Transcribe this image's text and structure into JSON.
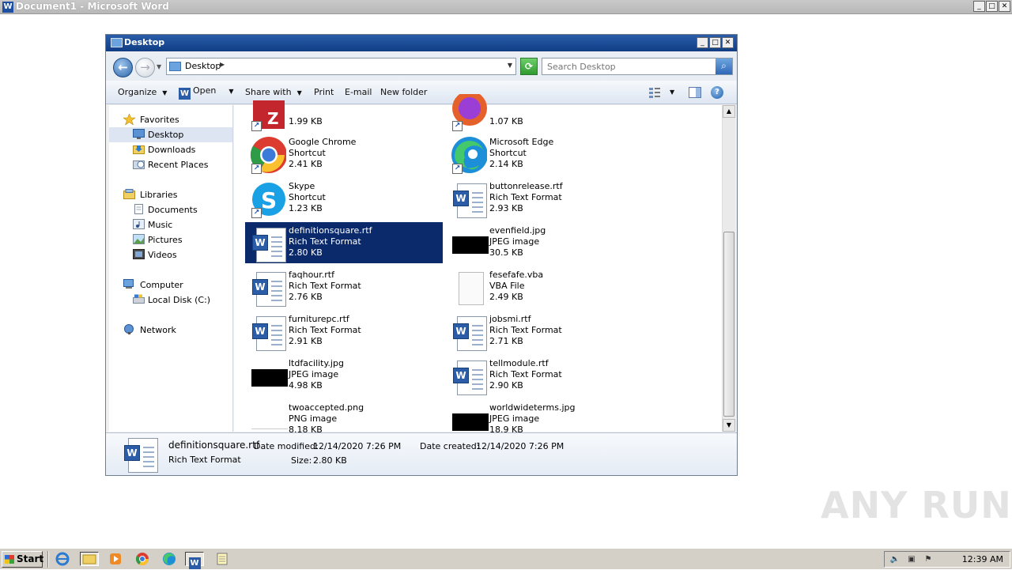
{
  "word_window": {
    "title": "Document1 - Microsoft Word",
    "app_icon_letter": "W"
  },
  "explorer": {
    "title": "Desktop",
    "address": {
      "location": "Desktop"
    },
    "search": {
      "placeholder": "Search Desktop"
    },
    "toolbar": {
      "organize": "Organize",
      "open": "Open",
      "share_with": "Share with",
      "print": "Print",
      "email": "E-mail",
      "new_folder": "New folder"
    },
    "navigation": {
      "favorites": "Favorites",
      "desktop": "Desktop",
      "downloads": "Downloads",
      "recent_places": "Recent Places",
      "libraries": "Libraries",
      "documents": "Documents",
      "music": "Music",
      "pictures": "Pictures",
      "videos": "Videos",
      "computer": "Computer",
      "local_disk": "Local Disk (C:)",
      "network": "Network"
    },
    "files": [
      {
        "name": "",
        "type": "",
        "size": "1.99 KB",
        "icon": "winrar-icon",
        "shortcut": true
      },
      {
        "name": "",
        "type": "",
        "size": "1.07 KB",
        "icon": "firefox-icon",
        "shortcut": true
      },
      {
        "name": "Google Chrome",
        "type": "Shortcut",
        "size": "2.41 KB",
        "icon": "chrome-icon",
        "shortcut": true
      },
      {
        "name": "Microsoft Edge",
        "type": "Shortcut",
        "size": "2.14 KB",
        "icon": "edge-icon",
        "shortcut": true
      },
      {
        "name": "Skype",
        "type": "Shortcut",
        "size": "1.23 KB",
        "icon": "skype-icon",
        "shortcut": true
      },
      {
        "name": "buttonrelease.rtf",
        "type": "Rich Text Format",
        "size": "2.93 KB",
        "icon": "word-doc-icon"
      },
      {
        "name": "definitionsquare.rtf",
        "type": "Rich Text Format",
        "size": "2.80 KB",
        "icon": "word-doc-icon",
        "selected": true
      },
      {
        "name": "evenfield.jpg",
        "type": "JPEG image",
        "size": "30.5 KB",
        "icon": "jpeg-thumbnail"
      },
      {
        "name": "faqhour.rtf",
        "type": "Rich Text Format",
        "size": "2.76 KB",
        "icon": "word-doc-icon"
      },
      {
        "name": "fesefafe.vba",
        "type": "VBA File",
        "size": "2.49 KB",
        "icon": "blank-file-icon"
      },
      {
        "name": "furniturepc.rtf",
        "type": "Rich Text Format",
        "size": "2.91 KB",
        "icon": "word-doc-icon"
      },
      {
        "name": "jobsmi.rtf",
        "type": "Rich Text Format",
        "size": "2.71 KB",
        "icon": "word-doc-icon"
      },
      {
        "name": "ltdfacility.jpg",
        "type": "JPEG image",
        "size": "4.98 KB",
        "icon": "jpeg-thumbnail"
      },
      {
        "name": "tellmodule.rtf",
        "type": "Rich Text Format",
        "size": "2.90 KB",
        "icon": "word-doc-icon"
      },
      {
        "name": "twoaccepted.png",
        "type": "PNG image",
        "size": "8.18 KB",
        "icon": "png-thumbnail"
      },
      {
        "name": "worldwideterms.jpg",
        "type": "JPEG image",
        "size": "18.9 KB",
        "icon": "jpeg-thumbnail"
      }
    ],
    "details": {
      "name": "definitionsquare.rtf",
      "type": "Rich Text Format",
      "date_modified_label": "Date modified:",
      "date_modified": "12/14/2020 7:26 PM",
      "size_label": "Size:",
      "size": "2.80 KB",
      "date_created_label": "Date created:",
      "date_created": "12/14/2020 7:26 PM"
    }
  },
  "taskbar": {
    "start_label": "Start",
    "clock": "12:39 AM"
  },
  "watermark": "ANY RUN",
  "colors": {
    "selection": "#0b2a6b",
    "explorer_title": "#1a4c98",
    "word_icon": "#2a5ca8"
  }
}
